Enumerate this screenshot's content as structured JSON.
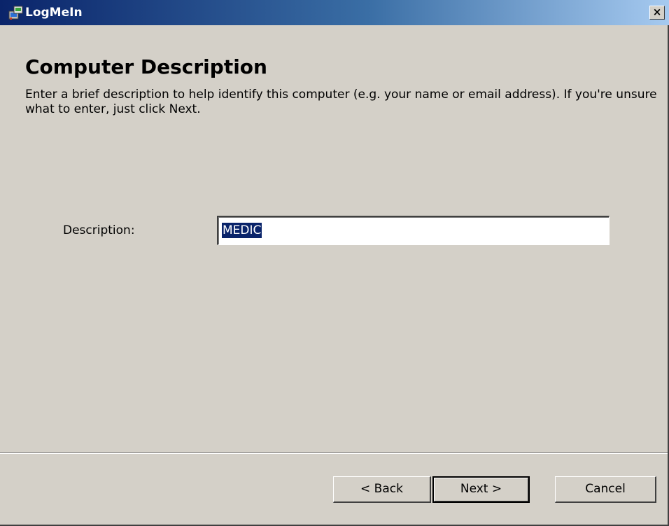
{
  "window": {
    "title": "LogMeIn",
    "close_label": "×",
    "app_icon": "logmein-installer-icon",
    "titlebar_colors": [
      "#0a246a",
      "#3a6ea5",
      "#a6caf0"
    ]
  },
  "page": {
    "heading": "Computer Description",
    "intro": "Enter a brief description to help identify this computer (e.g. your name or email address). If you're unsure what to enter, just click Next."
  },
  "form": {
    "description_label": "Description:",
    "description_value": "MEDIC"
  },
  "buttons": {
    "back": "< Back",
    "next": "Next >",
    "cancel": "Cancel"
  }
}
